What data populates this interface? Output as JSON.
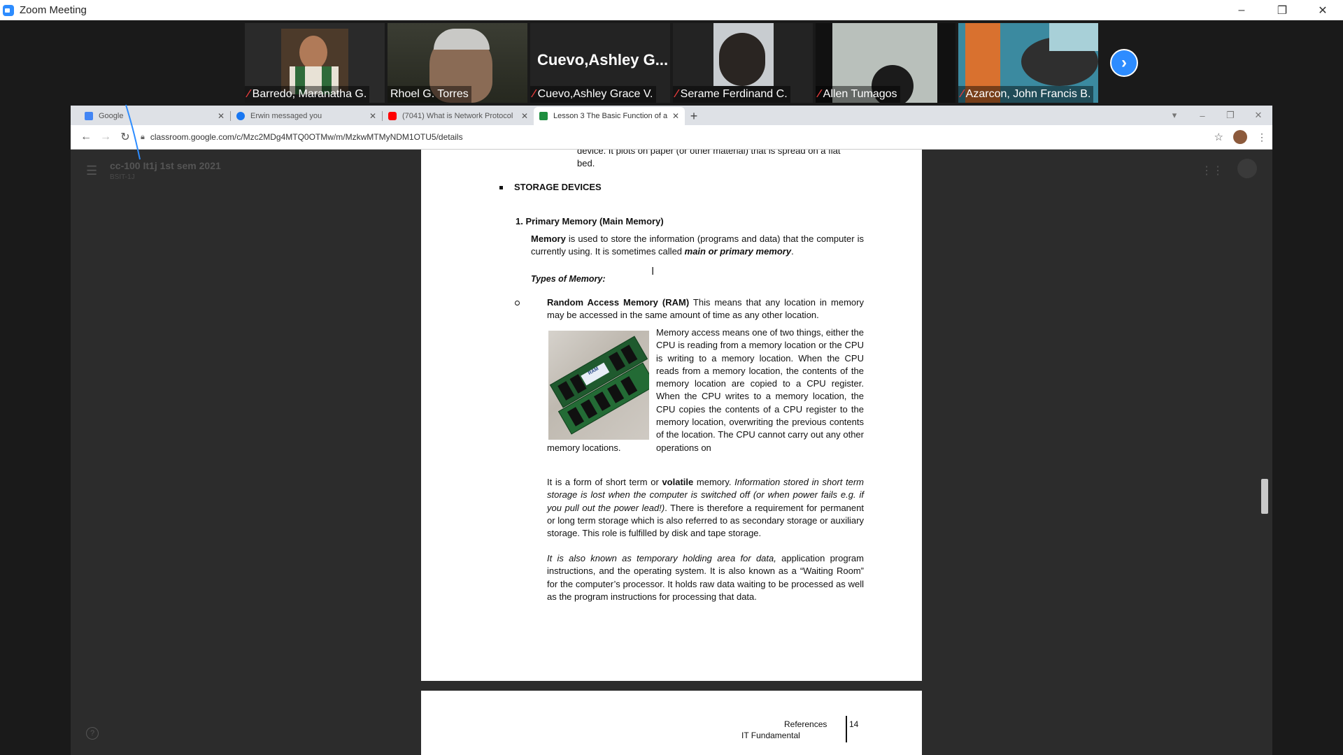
{
  "zoom": {
    "window_title": "Zoom Meeting",
    "controls": [
      "–",
      "❐",
      "✕"
    ],
    "participants": [
      {
        "name": "Barredo, Maranatha G.",
        "muted": true,
        "video": "graduation-photo"
      },
      {
        "name": "Rhoel G. Torres",
        "muted": false,
        "video": "camera",
        "active": true
      },
      {
        "name": "Cuevo,Ashley Grace V.",
        "muted": true,
        "video": "name-only",
        "display_name": "Cuevo,Ashley   G..."
      },
      {
        "name": "Serame Ferdinand C.",
        "muted": true,
        "video": "camera"
      },
      {
        "name": "Allen Tumagos",
        "muted": true,
        "video": "camera"
      },
      {
        "name": "Azarcon, John Francis B.",
        "muted": true,
        "video": "camera"
      }
    ],
    "next_icon": "chevron-right-icon"
  },
  "browser": {
    "tabs": [
      {
        "label": "Google",
        "icon": "google-icon",
        "color": "#4285f4"
      },
      {
        "label": "Erwin messaged you",
        "icon": "facebook-icon",
        "color": "#1877f2"
      },
      {
        "label": "(7041) What is Network Protocol",
        "icon": "youtube-icon",
        "color": "#ff0000"
      },
      {
        "label": "Lesson 3 The Basic Function of a",
        "icon": "classroom-icon",
        "color": "#1e8e3e",
        "active": true
      }
    ],
    "new_tab": "+",
    "url": "classroom.google.com/c/Mzc2MDg4MTQ0OTMw/m/MzkwMTMyNDM1OTU5/details"
  },
  "classroom": {
    "class_title": "cc-100 It1j 1st sem 2021",
    "class_sub": "BSIT-1J"
  },
  "document": {
    "clip_line1": "device. It plots on paper (or other material) that is spread on a flat",
    "clip_line2": "bed.",
    "bullet_heading": "STORAGE DEVICES",
    "num_heading": "1.   Primary Memory (Main Memory)",
    "memory_bold": "Memory",
    "memory_text": " is used to store the information (programs and data) that the computer is currently using. It is sometimes called ",
    "memory_em": "main or primary memory",
    "memory_end": ".",
    "types_label": "Types of Memory:",
    "ram_bold": "Random Access Memory (RAM)",
    "ram_text": " This means that any location in memory may be accessed in the same amount of time as any other location.",
    "ram_right": "Memory access means one of two things, either the CPU is reading from a memory location or the CPU is writing to a memory location. When the CPU reads from a memory location, the contents of the memory location are copied to a CPU register. When the CPU writes to a memory location, the CPU copies the contents of a CPU register to the memory location, overwriting the previous contents of the location. The CPU cannot carry out any other operations on",
    "ram_tail": "memory locations.",
    "p2_a": "It is a form of short term or ",
    "p2_bold": "volatile",
    "p2_b": " memory. ",
    "p2_em": "Information stored in short term storage is lost when the computer is switched off (or when power fails e.g. if you pull out the power lead!)",
    "p2_c": ". There is therefore a requirement for permanent or long term storage which is also referred to as secondary storage or auxiliary storage. This role is fulfilled by disk and tape storage.",
    "p3_em": "It is also known as temporary holding area for data,",
    "p3_text": " application program instructions, and the operating system. It is also known as a “Waiting Room” for the computer’s processor. It holds raw data waiting to be processed as well as the program instructions for processing that data.",
    "ram_image_label": "RAM",
    "footer_ref": "References",
    "footer_it": "IT Fundamental",
    "page_num": "14"
  }
}
